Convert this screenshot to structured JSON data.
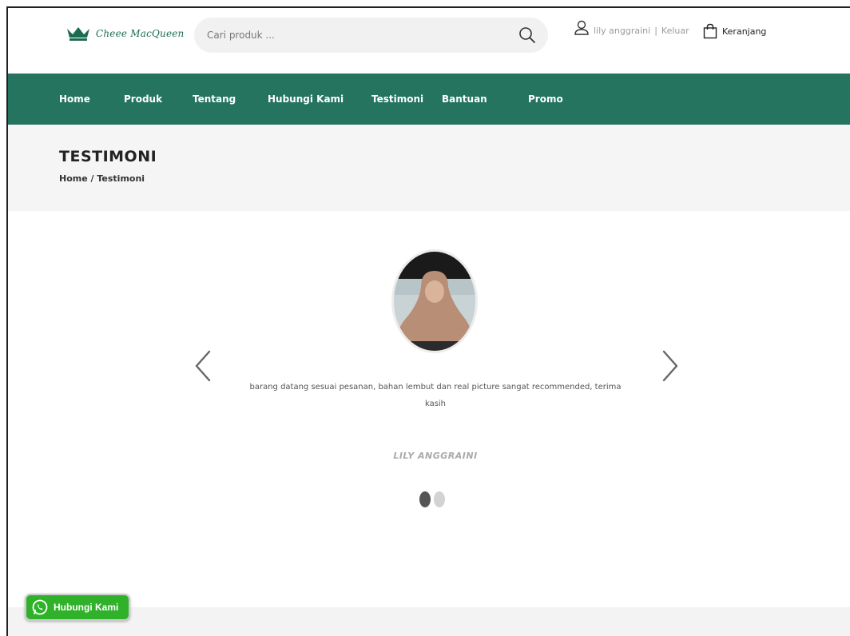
{
  "header": {
    "logo_text": "Cheee MacQueen",
    "search": {
      "placeholder": "Cari produk ..."
    },
    "user": {
      "name": "lily anggraini",
      "separator": "|",
      "logout": "Keluar"
    },
    "cart": {
      "label": "Keranjang"
    }
  },
  "nav": {
    "items": [
      {
        "label": "Home"
      },
      {
        "label": "Produk"
      },
      {
        "label": "Tentang"
      },
      {
        "label": "Hubungi Kami"
      },
      {
        "label": "Testimoni"
      },
      {
        "label": "Bantuan"
      },
      {
        "label": "Promo"
      }
    ]
  },
  "page": {
    "title": "TESTIMONI",
    "breadcrumb": "Home / Testimoni"
  },
  "testimonial": {
    "quote": "barang datang sesuai pesanan, bahan lembut dan real picture sangat recommended, terima kasih",
    "author": "LILY ANGGRAINI",
    "active_slide": 1,
    "slide_count": 2
  },
  "whatsapp": {
    "label": "Hubungi Kami"
  },
  "colors": {
    "brand_green": "#247460",
    "whatsapp_green": "#2fb12a",
    "band_gray": "#f5f5f5"
  }
}
